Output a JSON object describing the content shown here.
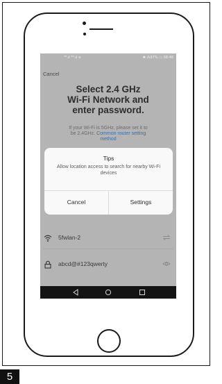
{
  "status_bar": {
    "signal_text": "⁴ᴳ.ıl ⁴ᴳ.ıl ≋",
    "right_text": "✱ ⁂97% ▭ 08:48"
  },
  "header": {
    "cancel_label": "Cancel"
  },
  "title": {
    "line1": "Select 2.4 GHz",
    "line2": "Wi-Fi Network and",
    "line3": "enter password."
  },
  "info": {
    "line1": "If your Wi-Fi is 5GHz, please set it to",
    "line2_prefix": "be 2.4GHz. ",
    "link_part1": "Common router setting",
    "link_part2": "method"
  },
  "tips_dialog": {
    "title": "Tips",
    "message": "Allow location access to search for nearby Wi-Fi devices",
    "cancel_label": "Cancel",
    "settings_label": "Settings"
  },
  "wifi_field": {
    "icon": "wifi-icon",
    "value": "5fwlan-2",
    "end_icon": "switch-network-icon"
  },
  "password_field": {
    "icon": "lock-icon",
    "value": "abcd@#123qwerty",
    "end_icon": "eye-icon"
  },
  "navbar": {
    "icons": [
      "back-triangle-icon",
      "home-circle-icon",
      "recents-square-icon"
    ]
  },
  "page_badge": {
    "number": "5"
  },
  "colors": {
    "screen_overlay": "#b4b4b4",
    "dialog_bg": "#f9f9f9",
    "link": "#3b6ea8",
    "navbar": "#141414"
  }
}
